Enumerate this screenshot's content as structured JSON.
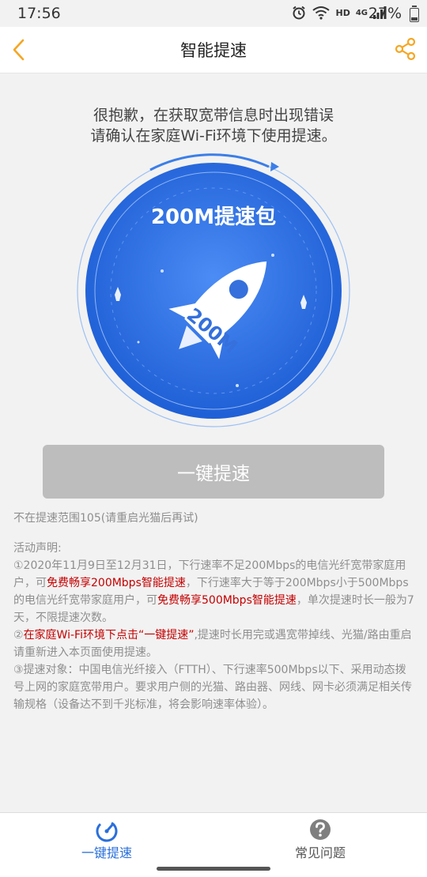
{
  "status": {
    "time": "17:56",
    "hd": "HD",
    "net": "4G",
    "battery": "27%"
  },
  "nav": {
    "title": "智能提速"
  },
  "main": {
    "message_line1": "很抱歉，在获取宽带信息时出现错误",
    "message_line2": "请确认在家庭Wi-Fi环境下使用提速。",
    "badge": "200M提速包",
    "rocket_text": "200M",
    "button_label": "一键提速",
    "range_text": "不在提速范围105(请重启光猫后再试)"
  },
  "notice": {
    "heading": "活动声明:",
    "p1_a": "①2020年11月9日至12月31日，下行速率不足200Mbps的电信光纤宽带家庭用户，可",
    "p1_b": "免费畅享200Mbps智能提速",
    "p1_c": "，下行速率大于等于200Mbps小于500Mbps的电信光纤宽带家庭用户，可",
    "p1_d": "免费畅享500Mbps智能提速",
    "p1_e": "，单次提速时长一般为7天，不限提速次数。",
    "p2_a": "②",
    "p2_b": "在家庭Wi-Fi环境下点击“一键提速”",
    "p2_c": ",提速时长用完或遇宽带掉线、光猫/路由重启请重新进入本页面使用提速。",
    "p3": "③提速对象：中国电信光纤接入（FTTH）、下行速率500Mbps以下、采用动态拨号上网的家庭宽带用户。要求用户侧的光猫、路由器、网线、网卡必须满足相关传输规格（设备达不到千兆标准，将会影响速率体验）。"
  },
  "tabs": [
    {
      "label": "一键提速"
    },
    {
      "label": "常见问题"
    }
  ],
  "colors": {
    "accent_orange": "#f5a623",
    "blue": "#2a6fdb",
    "red": "#c40000",
    "button_gray": "#bdbdbd"
  }
}
